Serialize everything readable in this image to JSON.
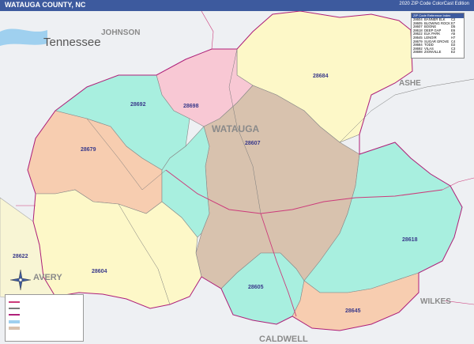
{
  "header": {
    "title": "WATAUGA COUNTY, NC",
    "edition": "2020 ZIP Code ColorCast Edition"
  },
  "map": {
    "county_label": "WATAUGA",
    "state_label": "Tennessee",
    "neighbors": {
      "johnson": "JOHNSON",
      "ashe": "ASHE",
      "wilkes": "WILKES",
      "avery": "AVERY",
      "caldwell": "CALDWELL"
    },
    "zips": {
      "z28692": "28692",
      "z28698": "28698",
      "z28684": "28684",
      "z28679": "28679",
      "z28607": "28607",
      "z28618": "28618",
      "z28622": "28622",
      "z28604": "28604",
      "z28605": "28605",
      "z28645": "28645"
    }
  },
  "legend": {
    "header": "ZIP Code Reference Index",
    "rows": [
      [
        "28604",
        "BANNER ELK",
        "C2"
      ],
      [
        "28605",
        "BLOWING ROCK",
        "E7"
      ],
      [
        "28607",
        "BOONE",
        "D5"
      ],
      [
        "28618",
        "DEEP GAP",
        "E6"
      ],
      [
        "28622",
        "ELK PARK",
        "A5"
      ],
      [
        "28645",
        "LENOIR",
        "H7"
      ],
      [
        "28679",
        "SUGAR GROVE",
        "C4"
      ],
      [
        "28684",
        "TODD",
        "D2"
      ],
      [
        "28692",
        "VILAS",
        "C3"
      ],
      [
        "28698",
        "ZIONVILLE",
        "E2"
      ]
    ]
  },
  "colors": {
    "z28607": "#d8c2ae",
    "z28618": "#a8efdf",
    "z28684": "#fdf8c8",
    "z28698": "#f8c8d4",
    "z28692": "#a8efdf",
    "z28679": "#f7cdb0",
    "z28604": "#fdf8c8",
    "z28605": "#a8efdf",
    "z28645": "#f7cdb0",
    "outside": "#eef0f3",
    "water": "#9fd0ef",
    "title_bar": "#3d5a9e"
  }
}
